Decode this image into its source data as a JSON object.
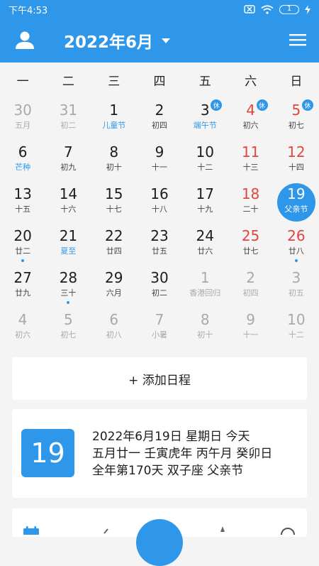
{
  "status_bar": {
    "time": "下午4:53",
    "battery": "1"
  },
  "header": {
    "title": "2022年6月"
  },
  "weekdays": [
    "一",
    "二",
    "三",
    "四",
    "五",
    "六",
    "日"
  ],
  "days": [
    {
      "num": "30",
      "sub": "五月",
      "grey": true
    },
    {
      "num": "31",
      "sub": "初二",
      "grey": true
    },
    {
      "num": "1",
      "sub": "儿童节",
      "subBlue": true
    },
    {
      "num": "2",
      "sub": "初四"
    },
    {
      "num": "3",
      "sub": "端午节",
      "subBlue": true,
      "badge": "休"
    },
    {
      "num": "4",
      "sub": "初六",
      "red": true,
      "badge": "休"
    },
    {
      "num": "5",
      "sub": "初七",
      "red": true,
      "badge": "休"
    },
    {
      "num": "6",
      "sub": "芒种",
      "subBlue": true
    },
    {
      "num": "7",
      "sub": "初九"
    },
    {
      "num": "8",
      "sub": "初十"
    },
    {
      "num": "9",
      "sub": "十一"
    },
    {
      "num": "10",
      "sub": "十二"
    },
    {
      "num": "11",
      "sub": "十三",
      "red": true
    },
    {
      "num": "12",
      "sub": "十四",
      "red": true
    },
    {
      "num": "13",
      "sub": "十五"
    },
    {
      "num": "14",
      "sub": "十六"
    },
    {
      "num": "15",
      "sub": "十七"
    },
    {
      "num": "16",
      "sub": "十八"
    },
    {
      "num": "17",
      "sub": "十九"
    },
    {
      "num": "18",
      "sub": "二十",
      "red": true
    },
    {
      "num": "19",
      "sub": "父亲节",
      "selected": true
    },
    {
      "num": "20",
      "sub": "廿二",
      "dot": true
    },
    {
      "num": "21",
      "sub": "夏至",
      "subBlue": true
    },
    {
      "num": "22",
      "sub": "廿四"
    },
    {
      "num": "23",
      "sub": "廿五"
    },
    {
      "num": "24",
      "sub": "廿六"
    },
    {
      "num": "25",
      "sub": "廿七",
      "red": true
    },
    {
      "num": "26",
      "sub": "廿八",
      "red": true,
      "dot": true
    },
    {
      "num": "27",
      "sub": "廿九"
    },
    {
      "num": "28",
      "sub": "三十",
      "dot": true
    },
    {
      "num": "29",
      "sub": "六月"
    },
    {
      "num": "30",
      "sub": "初二"
    },
    {
      "num": "1",
      "sub": "香港回归",
      "grey": true
    },
    {
      "num": "2",
      "sub": "初四",
      "grey": true
    },
    {
      "num": "3",
      "sub": "初五",
      "grey": true
    },
    {
      "num": "4",
      "sub": "初六",
      "grey": true
    },
    {
      "num": "5",
      "sub": "初七",
      "grey": true
    },
    {
      "num": "6",
      "sub": "初八",
      "grey": true
    },
    {
      "num": "7",
      "sub": "小暑",
      "grey": true
    },
    {
      "num": "8",
      "sub": "初十",
      "grey": true
    },
    {
      "num": "9",
      "sub": "十一",
      "grey": true
    },
    {
      "num": "10",
      "sub": "十二",
      "grey": true
    }
  ],
  "add_event": {
    "label": "+ 添加日程"
  },
  "today_card": {
    "day": "19",
    "line1": "2022年6月19日 星期日 今天",
    "line2": "五月廿一 壬寅虎年 丙午月 癸卯日",
    "line3": "全年第170天 双子座 父亲节"
  },
  "colors": {
    "accent": "#2f97ea",
    "weekend_red": "#e0463d",
    "muted": "#a9a9a9"
  }
}
